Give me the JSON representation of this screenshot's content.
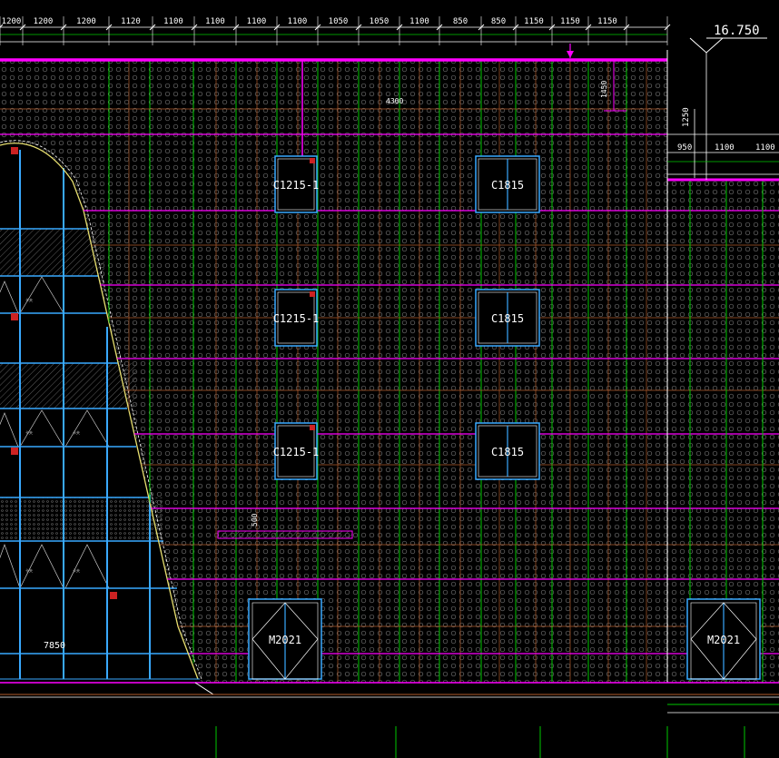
{
  "top_dimensions": [
    "1200",
    "1200",
    "1200",
    "1120",
    "1100",
    "1100",
    "1100",
    "1100",
    "1050",
    "1050",
    "1100",
    "850",
    "850",
    "1150",
    "1150",
    "1150"
  ],
  "elevation_mark": "16.750",
  "right_dimensions": [
    "950",
    "1100",
    "1100"
  ],
  "vertical_dims": {
    "a": "1450",
    "b": "1250"
  },
  "span_label": "4300",
  "small_dim": "500",
  "bottom_left_dim": "7850",
  "windows_left_label": "C1215-1",
  "windows_right_label": "C1815",
  "door_label": "M2021",
  "annotation_text": "卡夫",
  "colors": {
    "magenta": "#ff00ff",
    "green": "#00c800",
    "cyan": "#39a9ff",
    "red": "#ff2020",
    "orange": "#b05a2a",
    "white": "#ffffff",
    "yellow": "#e8e070",
    "dots": "#6e6e6e"
  }
}
